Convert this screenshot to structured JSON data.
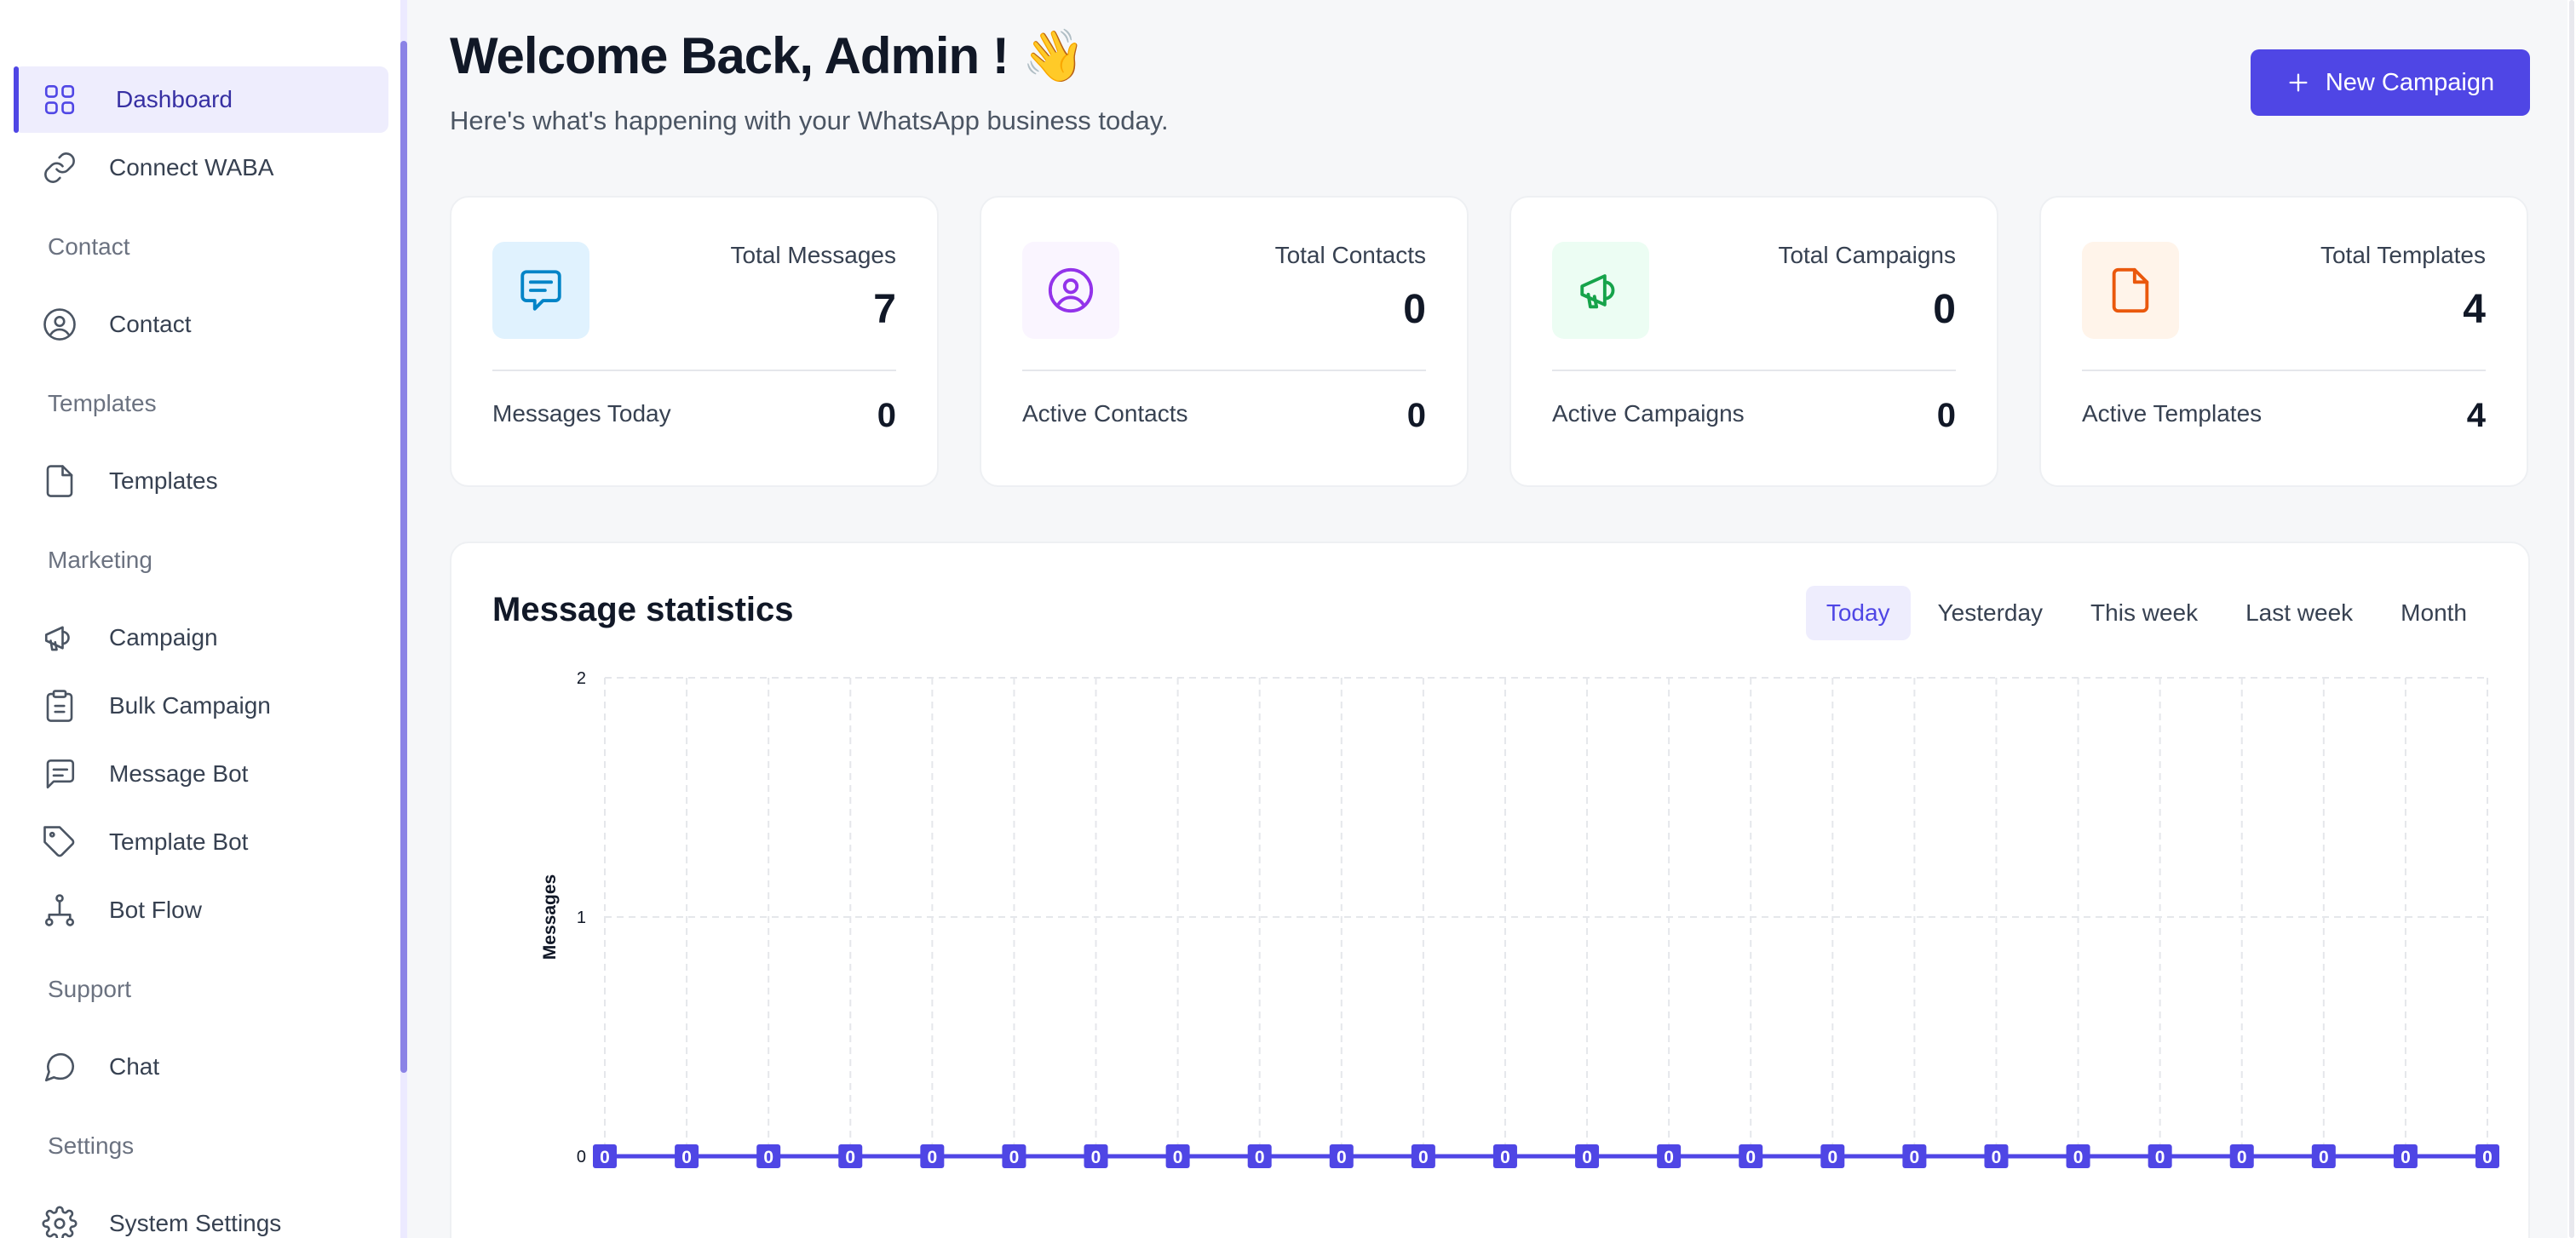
{
  "sidebar": {
    "items": [
      {
        "label": "Dashboard",
        "icon": "grid-icon",
        "active": true
      },
      {
        "label": "Connect WABA",
        "icon": "link-icon"
      },
      {
        "section": "Contact"
      },
      {
        "label": "Contact",
        "icon": "user-circle-icon"
      },
      {
        "section": "Templates"
      },
      {
        "label": "Templates",
        "icon": "file-icon"
      },
      {
        "section": "Marketing"
      },
      {
        "label": "Campaign",
        "icon": "megaphone-icon"
      },
      {
        "label": "Bulk Campaign",
        "icon": "clipboard-copy-icon"
      },
      {
        "label": "Message Bot",
        "icon": "message-square-icon"
      },
      {
        "label": "Template Bot",
        "icon": "tag-icon"
      },
      {
        "label": "Bot Flow",
        "icon": "network-icon"
      },
      {
        "section": "Support"
      },
      {
        "label": "Chat",
        "icon": "chat-bubble-icon"
      },
      {
        "section": "Settings"
      },
      {
        "label": "System Settings",
        "icon": "gear-icon"
      }
    ]
  },
  "header": {
    "title": "Welcome Back, Admin ! 👋",
    "subtitle": "Here's what's happening with your WhatsApp business today.",
    "new_campaign_label": "New Campaign"
  },
  "cards": [
    {
      "title": "Total Messages",
      "value": "7",
      "foot_label": "Messages Today",
      "foot_value": "0",
      "icon": "message-icon",
      "icon_bg": "#e0f2fe",
      "icon_color": "#0284c7"
    },
    {
      "title": "Total Contacts",
      "value": "0",
      "foot_label": "Active Contacts",
      "foot_value": "0",
      "icon": "user-circle-icon",
      "icon_bg": "#faf5ff",
      "icon_color": "#9333ea"
    },
    {
      "title": "Total Campaigns",
      "value": "0",
      "foot_label": "Active Campaigns",
      "foot_value": "0",
      "icon": "megaphone-icon",
      "icon_bg": "#ecfdf3",
      "icon_color": "#16a34a"
    },
    {
      "title": "Total Templates",
      "value": "4",
      "foot_label": "Active Templates",
      "foot_value": "4",
      "icon": "file-icon",
      "icon_bg": "#fff4ea",
      "icon_color": "#ea580c"
    }
  ],
  "stats": {
    "title": "Message statistics",
    "tabs": [
      "Today",
      "Yesterday",
      "This week",
      "Last week",
      "Month"
    ],
    "active_tab": "Today"
  },
  "chart_data": {
    "type": "line",
    "ylabel": "Messages",
    "xlabel": "",
    "ylim": [
      0,
      2
    ],
    "yticks": [
      "0",
      "1",
      "2"
    ],
    "grid": true,
    "series": [
      {
        "values": [
          0,
          0,
          0,
          0,
          0,
          0,
          0,
          0,
          0,
          0,
          0,
          0,
          0,
          0,
          0,
          0,
          0,
          0,
          0,
          0,
          0,
          0,
          0,
          0
        ],
        "color": "#4f46e5"
      }
    ],
    "data_labels": true
  }
}
